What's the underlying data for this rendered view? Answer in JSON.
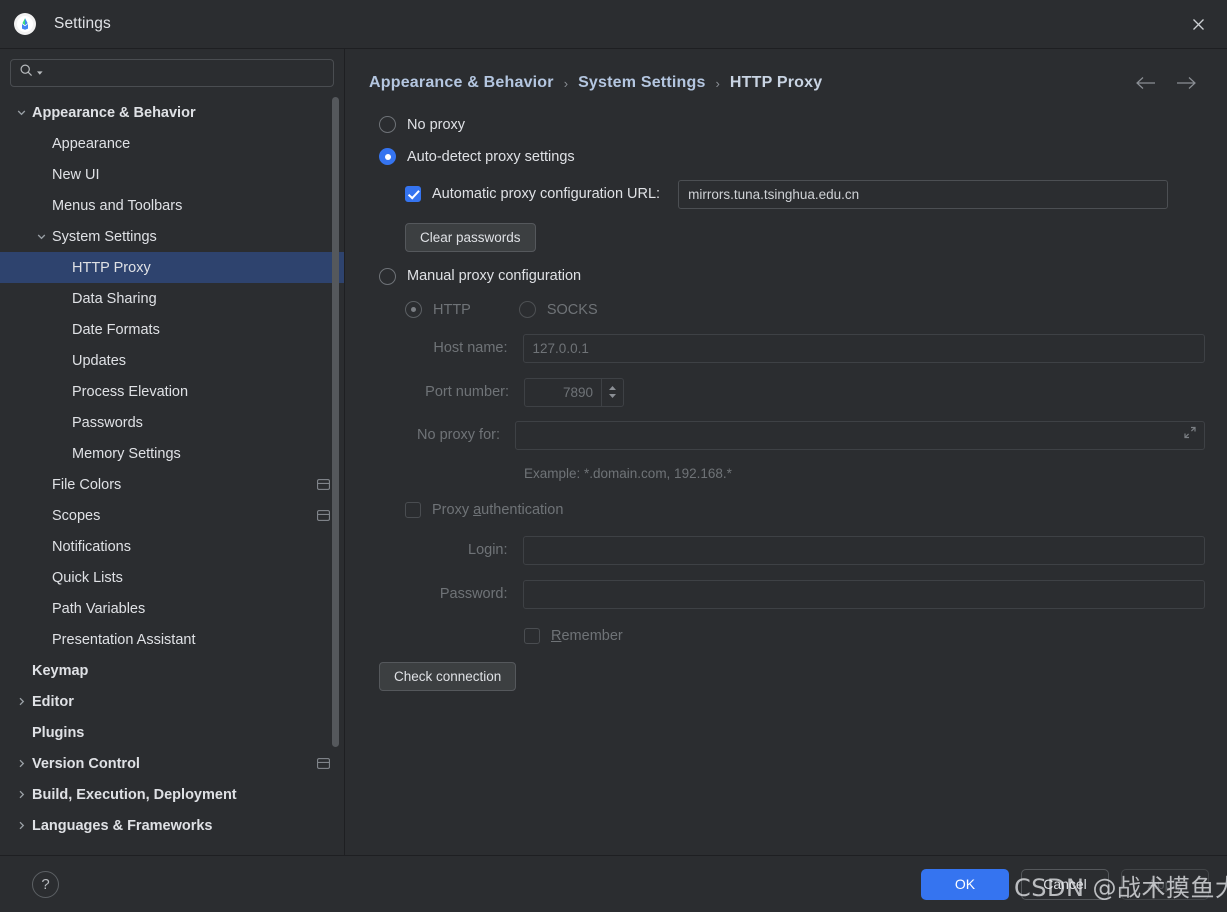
{
  "window": {
    "title": "Settings",
    "app_icon": "android-studio-icon",
    "close_icon": "close-icon"
  },
  "sidebar": {
    "search": {
      "placeholder": "",
      "value": "",
      "icon": "search-icon"
    },
    "items": [
      {
        "label": "Appearance & Behavior",
        "depth": 0,
        "bold": true,
        "chevron": "down",
        "selected": false,
        "badge": false
      },
      {
        "label": "Appearance",
        "depth": 1,
        "bold": false,
        "chevron": "none",
        "selected": false,
        "badge": false
      },
      {
        "label": "New UI",
        "depth": 1,
        "bold": false,
        "chevron": "none",
        "selected": false,
        "badge": false
      },
      {
        "label": "Menus and Toolbars",
        "depth": 1,
        "bold": false,
        "chevron": "none",
        "selected": false,
        "badge": false
      },
      {
        "label": "System Settings",
        "depth": 1,
        "bold": false,
        "chevron": "down",
        "selected": false,
        "badge": false
      },
      {
        "label": "HTTP Proxy",
        "depth": 2,
        "bold": false,
        "chevron": "none",
        "selected": true,
        "badge": false
      },
      {
        "label": "Data Sharing",
        "depth": 2,
        "bold": false,
        "chevron": "none",
        "selected": false,
        "badge": false
      },
      {
        "label": "Date Formats",
        "depth": 2,
        "bold": false,
        "chevron": "none",
        "selected": false,
        "badge": false
      },
      {
        "label": "Updates",
        "depth": 2,
        "bold": false,
        "chevron": "none",
        "selected": false,
        "badge": false
      },
      {
        "label": "Process Elevation",
        "depth": 2,
        "bold": false,
        "chevron": "none",
        "selected": false,
        "badge": false
      },
      {
        "label": "Passwords",
        "depth": 2,
        "bold": false,
        "chevron": "none",
        "selected": false,
        "badge": false
      },
      {
        "label": "Memory Settings",
        "depth": 2,
        "bold": false,
        "chevron": "none",
        "selected": false,
        "badge": false
      },
      {
        "label": "File Colors",
        "depth": 1,
        "bold": false,
        "chevron": "none",
        "selected": false,
        "badge": true
      },
      {
        "label": "Scopes",
        "depth": 1,
        "bold": false,
        "chevron": "none",
        "selected": false,
        "badge": true
      },
      {
        "label": "Notifications",
        "depth": 1,
        "bold": false,
        "chevron": "none",
        "selected": false,
        "badge": false
      },
      {
        "label": "Quick Lists",
        "depth": 1,
        "bold": false,
        "chevron": "none",
        "selected": false,
        "badge": false
      },
      {
        "label": "Path Variables",
        "depth": 1,
        "bold": false,
        "chevron": "none",
        "selected": false,
        "badge": false
      },
      {
        "label": "Presentation Assistant",
        "depth": 1,
        "bold": false,
        "chevron": "none",
        "selected": false,
        "badge": false
      },
      {
        "label": "Keymap",
        "depth": 0,
        "bold": true,
        "chevron": "none",
        "selected": false,
        "badge": false
      },
      {
        "label": "Editor",
        "depth": 0,
        "bold": true,
        "chevron": "right",
        "selected": false,
        "badge": false
      },
      {
        "label": "Plugins",
        "depth": 0,
        "bold": true,
        "chevron": "none",
        "selected": false,
        "badge": false
      },
      {
        "label": "Version Control",
        "depth": 0,
        "bold": true,
        "chevron": "right",
        "selected": false,
        "badge": true
      },
      {
        "label": "Build, Execution, Deployment",
        "depth": 0,
        "bold": true,
        "chevron": "right",
        "selected": false,
        "badge": false
      },
      {
        "label": "Languages & Frameworks",
        "depth": 0,
        "bold": true,
        "chevron": "right",
        "selected": false,
        "badge": false
      }
    ]
  },
  "breadcrumb": {
    "items": [
      "Appearance & Behavior",
      "System Settings",
      "HTTP Proxy"
    ],
    "separator": "›",
    "back_icon": "arrow-left-icon",
    "forward_icon": "arrow-right-icon"
  },
  "proxy": {
    "no_proxy": {
      "label": "No proxy",
      "checked": false
    },
    "auto_detect": {
      "label": "Auto-detect proxy settings",
      "checked": true
    },
    "auto_config_url": {
      "label": "Automatic proxy configuration URL:",
      "checked": true,
      "value": "mirrors.tuna.tsinghua.edu.cn",
      "placeholder": ""
    },
    "clear_passwords_label": "Clear passwords",
    "manual": {
      "label": "Manual proxy configuration",
      "checked": false
    },
    "protocol": {
      "http": {
        "label": "HTTP",
        "checked": true
      },
      "socks": {
        "label": "SOCKS",
        "checked": false
      }
    },
    "host_name": {
      "label": "Host name:",
      "value": "127.0.0.1"
    },
    "port_number": {
      "label": "Port number:",
      "value": "7890"
    },
    "no_proxy_for": {
      "label": "No proxy for:",
      "value": "",
      "expand_icon": "expand-icon"
    },
    "example_text": "Example: *.domain.com, 192.168.*",
    "proxy_auth": {
      "label_before": "Proxy ",
      "mnemonic": "a",
      "label_after": "uthentication",
      "checked": false
    },
    "login": {
      "label": "Login:",
      "value": ""
    },
    "password": {
      "label": "Password:",
      "value": ""
    },
    "remember": {
      "mnemonic": "R",
      "label_after": "emember",
      "checked": false
    },
    "check_connection_label": "Check connection"
  },
  "footer": {
    "help_label": "?",
    "ok_label": "OK",
    "cancel_label": "Cancel",
    "apply_label": "Apply"
  },
  "watermark": {
    "text": "CSDN @战术摸鱼大师"
  },
  "colors": {
    "accent": "#3574f0",
    "selection": "#2e436e",
    "background": "#2b2d30",
    "text": "#dfe1e5",
    "text_disabled": "#6f7377",
    "breadcrumb": "#b4c6e0"
  }
}
